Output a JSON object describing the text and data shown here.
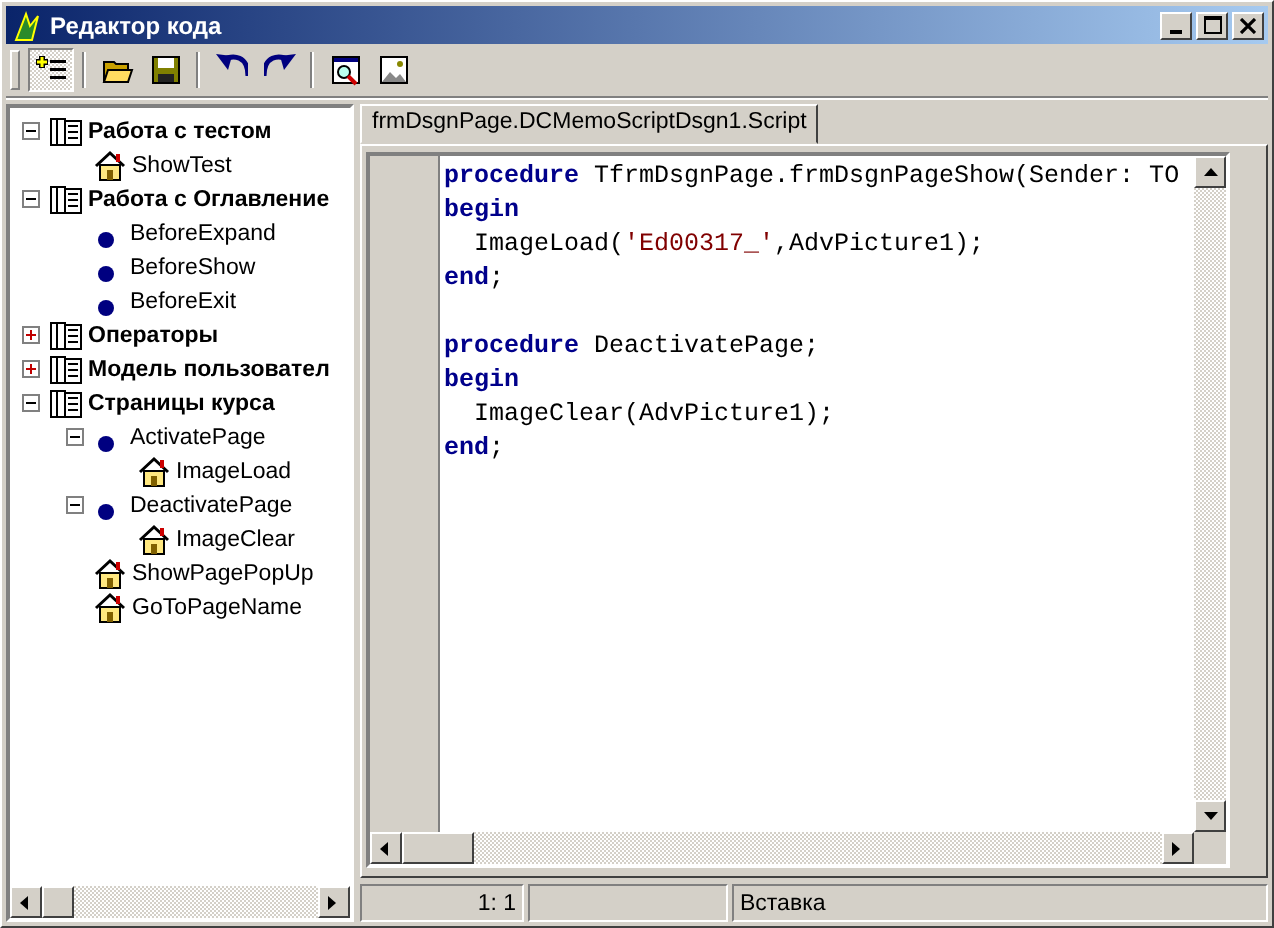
{
  "window": {
    "title": "Редактор кода"
  },
  "toolbar": [
    {
      "pressed": true
    },
    {
      "pressed": false
    },
    {
      "pressed": false
    },
    {
      "pressed": false
    },
    {
      "pressed": false
    },
    {
      "pressed": false
    },
    {
      "pressed": false
    }
  ],
  "tree": [
    {
      "label": "Работа с тестом",
      "kind": "group",
      "expanded": true,
      "children": [
        {
          "label": "ShowTest",
          "kind": "action"
        }
      ]
    },
    {
      "label": "Работа с Оглавление",
      "kind": "group",
      "expanded": true,
      "children": [
        {
          "label": "BeforeExpand",
          "kind": "event"
        },
        {
          "label": "BeforeShow",
          "kind": "event"
        },
        {
          "label": "BeforeExit",
          "kind": "event"
        }
      ]
    },
    {
      "label": "Операторы",
      "kind": "group",
      "expanded": false
    },
    {
      "label": "Модель пользовател",
      "kind": "group",
      "expanded": false
    },
    {
      "label": "Страницы курса",
      "kind": "group",
      "expanded": true,
      "children": [
        {
          "label": "ActivatePage",
          "kind": "event",
          "expanded": true,
          "children": [
            {
              "label": "ImageLoad",
              "kind": "action"
            }
          ]
        },
        {
          "label": "DeactivatePage",
          "kind": "event",
          "expanded": true,
          "children": [
            {
              "label": "ImageClear",
              "kind": "action"
            }
          ]
        },
        {
          "label": "ShowPagePopUp",
          "kind": "action"
        },
        {
          "label": "GoToPageName",
          "kind": "action"
        }
      ]
    }
  ],
  "tabs": [
    {
      "label": "frmDsgnPage.DCMemoScriptDsgn1.Script",
      "selected": true
    }
  ],
  "code": [
    {
      "kind": "code",
      "tokens": [
        {
          "kind": "keyword",
          "text": "procedure"
        },
        {
          "kind": "plain",
          "text": " TfrmDsgnPage.frmDsgnPageShow(Sender: TO"
        }
      ]
    },
    {
      "kind": "code",
      "tokens": [
        {
          "kind": "keyword",
          "text": "begin"
        }
      ]
    },
    {
      "kind": "code",
      "tokens": [
        {
          "kind": "plain",
          "text": "  ImageLoad("
        },
        {
          "kind": "string",
          "text": "'Ed00317_'"
        },
        {
          "kind": "plain",
          "text": ",AdvPicture1);"
        }
      ]
    },
    {
      "kind": "code",
      "tokens": [
        {
          "kind": "keyword",
          "text": "end"
        },
        {
          "kind": "plain",
          "text": ";"
        }
      ]
    },
    {
      "kind": "blank"
    },
    {
      "kind": "code",
      "tokens": [
        {
          "kind": "keyword",
          "text": "procedure"
        },
        {
          "kind": "plain",
          "text": " DeactivatePage;"
        }
      ]
    },
    {
      "kind": "code",
      "tokens": [
        {
          "kind": "keyword",
          "text": "begin"
        }
      ]
    },
    {
      "kind": "code",
      "tokens": [
        {
          "kind": "plain",
          "text": "  ImageClear(AdvPicture1);"
        }
      ]
    },
    {
      "kind": "code",
      "tokens": [
        {
          "kind": "keyword",
          "text": "end"
        },
        {
          "kind": "plain",
          "text": ";"
        }
      ]
    }
  ],
  "status_bar": {
    "position": "1: 1",
    "mode": "Вставка"
  }
}
